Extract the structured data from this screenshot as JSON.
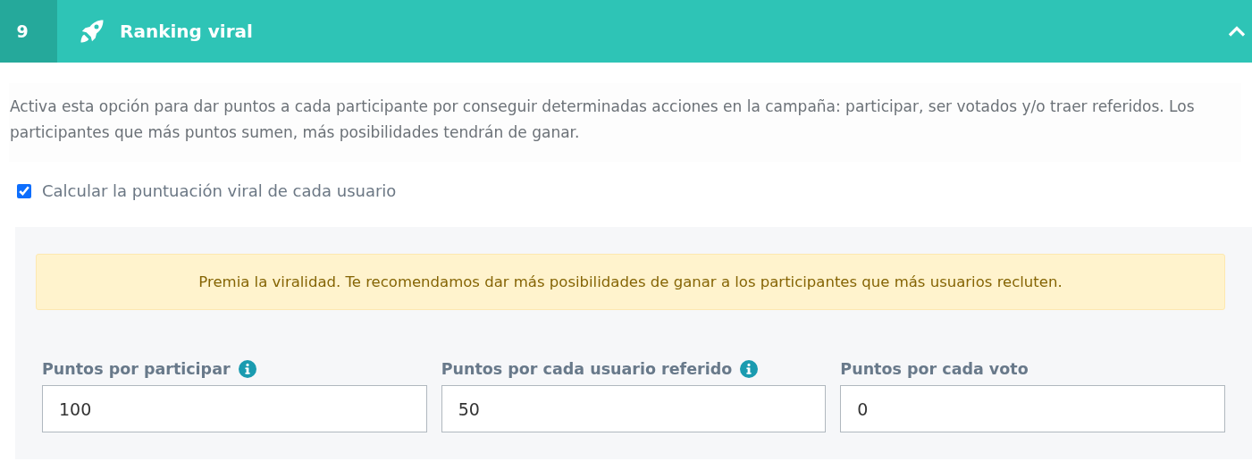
{
  "header": {
    "number": "9",
    "title": "Ranking viral",
    "expanded": true
  },
  "description": "Activa esta opción para dar puntos a cada participante por conseguir determinadas acciones en la campaña: participar, ser votados y/o traer referidos. Los participantes que más puntos sumen, más posibilidades tendrán de ganar.",
  "option": {
    "label": "Calcular la puntuación viral de cada usuario",
    "checked": true
  },
  "alert": "Premia la viralidad. Te recomendamos dar más posibilidades de ganar a los participantes que más usuarios recluten.",
  "fields": [
    {
      "label": "Puntos por participar",
      "info": true,
      "value": "100"
    },
    {
      "label": "Puntos por cada usuario referido",
      "info": true,
      "value": "50"
    },
    {
      "label": "Puntos por cada voto",
      "info": false,
      "value": "0"
    }
  ]
}
